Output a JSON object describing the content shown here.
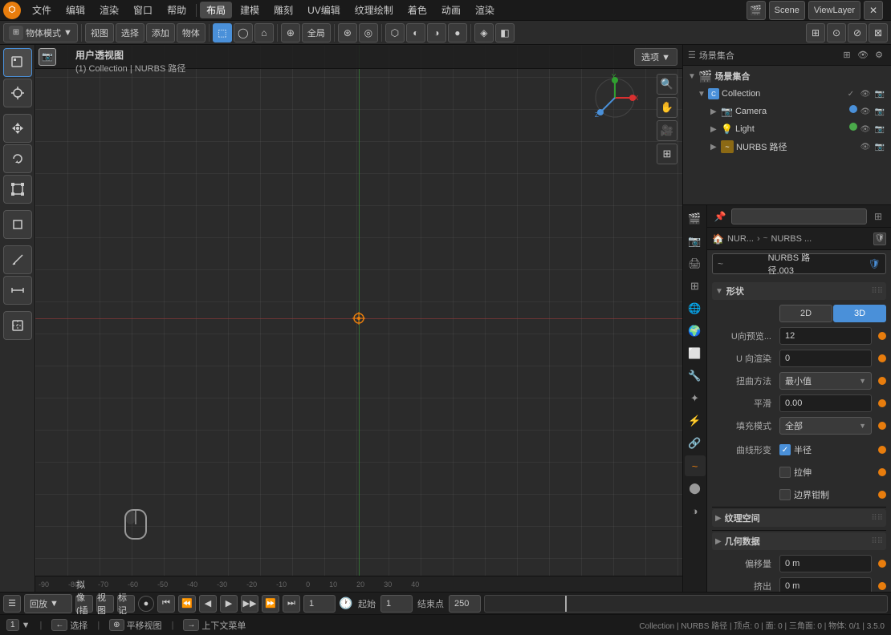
{
  "app": {
    "title": "Blender",
    "scene": "Scene",
    "view_layer": "ViewLayer"
  },
  "top_menu": {
    "items": [
      "文件",
      "编辑",
      "渲染",
      "窗口",
      "帮助"
    ],
    "active": "布局",
    "workspace_tabs": [
      "布局",
      "建模",
      "雕刻",
      "UV编辑",
      "纹理绘制",
      "着色",
      "动画",
      "渲染"
    ]
  },
  "toolbar": {
    "mode": "物体模式",
    "mode_icon": "▼",
    "view_btn": "视图",
    "select_btn": "选择",
    "add_btn": "添加",
    "object_btn": "物体",
    "global_label": "全局",
    "icons": [
      "⊞",
      "↻",
      "⊕",
      "⊛",
      "◯",
      "✦",
      "▣",
      "⬡",
      "◈"
    ]
  },
  "viewport": {
    "info_title": "用户透视图",
    "info_sub": "(1) Collection | NURBS 路径",
    "options_btn": "选项 ▼"
  },
  "timeline": {
    "playback_frame": "1",
    "start_frame": "1",
    "end_frame": "250",
    "start_label": "起始",
    "end_label": "结束点"
  },
  "statusbar": {
    "left": "选择",
    "middle": "平移视图",
    "right": "上下文菜单",
    "info": "Collection | NURBS 路径 | 顶点: 0 | 面: 0 | 三角面: 0 | 物体: 0/1 | 3.5.0"
  },
  "outliner": {
    "title": "场景集合",
    "items": [
      {
        "type": "collection",
        "label": "Collection",
        "icon": "collection",
        "expanded": true,
        "children": [
          {
            "type": "camera",
            "label": "Camera",
            "icon": "camera"
          },
          {
            "type": "light",
            "label": "Light",
            "icon": "light"
          },
          {
            "type": "curve",
            "label": "NURBS 路径",
            "icon": "curve"
          }
        ]
      }
    ]
  },
  "properties": {
    "breadcrumb_items": [
      "NUR...",
      "NURBS ..."
    ],
    "object_name": "NURBS 路径.003",
    "tabs": [
      "scene",
      "render",
      "output",
      "view_layer",
      "scene2",
      "world",
      "object",
      "modifier",
      "particles",
      "physics",
      "constraints",
      "data",
      "material",
      "shading"
    ],
    "active_tab": "data",
    "sections": {
      "geometry": {
        "label": "形状",
        "expanded": true,
        "mode_2d": "2D",
        "mode_3d": "3D",
        "active_mode": "3D",
        "u_preview_label": "U向预览...",
        "u_preview_value": "12",
        "u_render_label": "U 向渲染",
        "u_render_value": "0",
        "twist_label": "扭曲方法",
        "twist_value": "最小值",
        "smooth_label": "平滑",
        "smooth_value": "0.00",
        "fill_label": "填充模式",
        "fill_value": "全部",
        "curve_deform_label": "曲线形变",
        "half_radius_label": "半径",
        "stretch_label": "拉伸",
        "bound_clamp_label": "边界钳制"
      }
    },
    "texture_space": {
      "label": "纹理空间",
      "expanded": false
    },
    "geometry_data": {
      "label": "几何数据",
      "expanded": false,
      "offset_label": "偏移量",
      "offset_value": "0 m",
      "extrude_label": "挤出",
      "extrude_value": "0 m"
    }
  }
}
